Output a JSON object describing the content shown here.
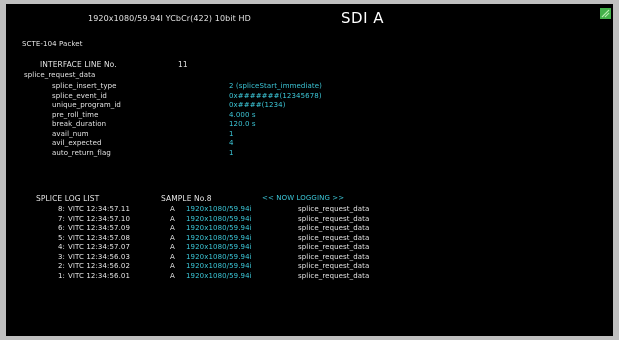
{
  "header": {
    "format": "1920x1080/59.94I YCbCr(422) 10bit HD",
    "input": "SDI A",
    "status_icon": "status-led-icon",
    "status_color": "#43b14a"
  },
  "packet": {
    "title": "SCTE-104 Packet",
    "interface_line_label": "INTERFACE LINE No.",
    "interface_line_value": "11",
    "request_title": "splice_request_data",
    "fields": [
      {
        "label": "splice_insert_type",
        "value": "2 (spliceStart_immediate)"
      },
      {
        "label": "splice_event_id",
        "value": "0x#######(12345678)"
      },
      {
        "label": "unique_program_id",
        "value": "0x####(1234)"
      },
      {
        "label": "pre_roll_time",
        "value": "4.000 s"
      },
      {
        "label": "break_duration",
        "value": "120.0 s"
      },
      {
        "label": "avail_num",
        "value": "1"
      },
      {
        "label": "avil_expected",
        "value": "4"
      },
      {
        "label": "auto_return_flag",
        "value": "1"
      }
    ]
  },
  "log": {
    "title": "SPLICE LOG LIST",
    "sample_label": "SAMPLE No.8",
    "status": "<< NOW LOGGING >>",
    "rows": [
      {
        "index": "8:",
        "time": "VITC 12:34:57.11",
        "channel": "A",
        "format": "1920x1080/59.94i",
        "type": "splice_request_data"
      },
      {
        "index": "7:",
        "time": "VITC 12:34:57.10",
        "channel": "A",
        "format": "1920x1080/59.94i",
        "type": "splice_request_data"
      },
      {
        "index": "6:",
        "time": "VITC 12:34:57.09",
        "channel": "A",
        "format": "1920x1080/59.94i",
        "type": "splice_request_data"
      },
      {
        "index": "5:",
        "time": "VITC 12:34:57.08",
        "channel": "A",
        "format": "1920x1080/59.94i",
        "type": "splice_request_data"
      },
      {
        "index": "4:",
        "time": "VITC 12:34:57.07",
        "channel": "A",
        "format": "1920x1080/59.94i",
        "type": "splice_request_data"
      },
      {
        "index": "3:",
        "time": "VITC 12:34:56.03",
        "channel": "A",
        "format": "1920x1080/59.94i",
        "type": "splice_request_data"
      },
      {
        "index": "2:",
        "time": "VITC 12:34:56.02",
        "channel": "A",
        "format": "1920x1080/59.94i",
        "type": "splice_request_data"
      },
      {
        "index": "1:",
        "time": "VITC 12:34:56.01",
        "channel": "A",
        "format": "1920x1080/59.94i",
        "type": "splice_request_data"
      }
    ]
  }
}
